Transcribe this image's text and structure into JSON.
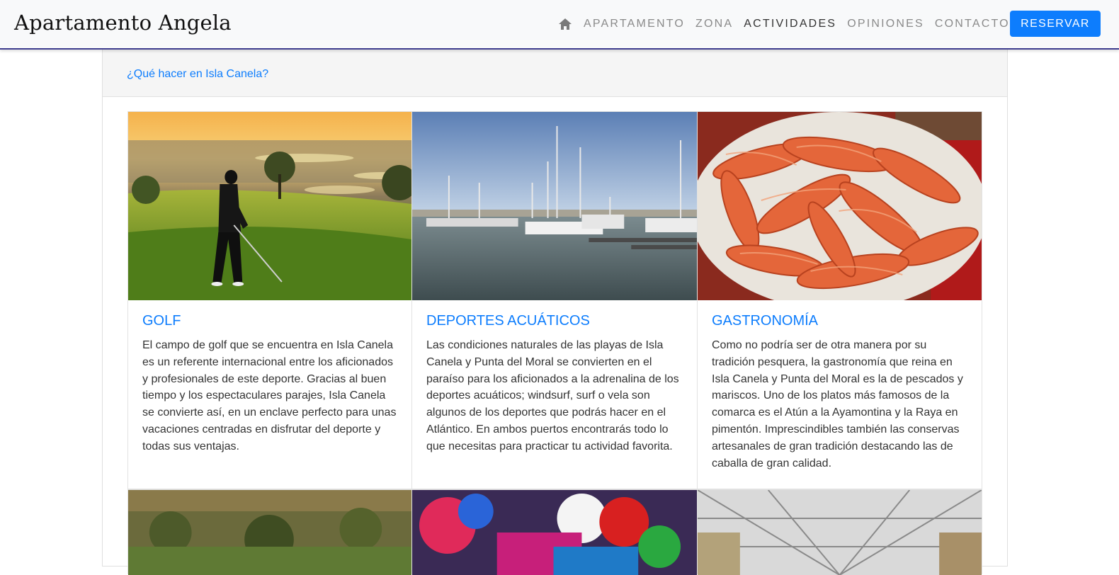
{
  "brand": "Apartamento Angela",
  "nav": {
    "links": [
      "APARTAMENTO",
      "ZONA",
      "ACTIVIDADES",
      "OPINIONES",
      "CONTACTO"
    ],
    "active": "ACTIVIDADES",
    "reserve_label": "RESERVAR"
  },
  "section": {
    "header_link": "¿Qué hacer en Isla Canela?"
  },
  "activities": [
    {
      "title": "GOLF",
      "text": "El campo de golf que se encuentra en Isla Canela es un referente internacional entre los aficionados y profesionales de este deporte. Gracias al buen tiempo y los espectaculares parajes, Isla Canela se convierte así, en un enclave perfecto para unas vacaciones centradas en disfrutar del deporte y todas sus ventajas."
    },
    {
      "title": "DEPORTES ACUÁTICOS",
      "text": "Las condiciones naturales de las playas de Isla Canela y Punta del Moral se convierten en el paraíso para los aficionados a la adrenalina de los deportes acuáticos; windsurf, surf o vela son algunos de los deportes que podrás hacer en el Atlántico. En ambos puertos encontrarás todo lo que necesitas para practicar tu actividad favorita."
    },
    {
      "title": "GASTRONOMÍA",
      "text": "Como no podría ser de otra manera por su tradición pesquera, la gastronomía que reina en Isla Canela y Punta del Moral es la de pescados y mariscos. Uno de los platos más famosos de la comarca es el Atún a la Ayamontina y la Raya en pimentón. Imprescindibles también las conservas artesanales de gran tradición destacando las de caballa de gran calidad."
    }
  ],
  "colors": {
    "accent": "#0d7dfd",
    "navbar_bg": "#f8f9fa",
    "navbar_border": "#3f3d8f"
  }
}
